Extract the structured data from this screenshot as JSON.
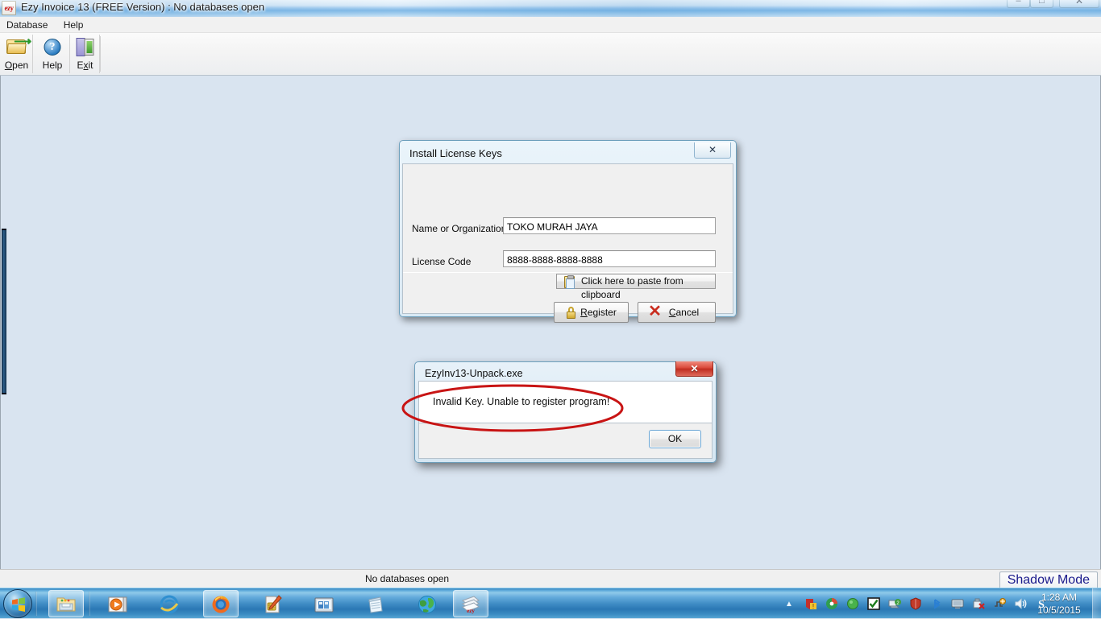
{
  "window": {
    "app_icon": "ezy",
    "title": "Ezy Invoice 13 (FREE Version)  : No databases open",
    "minimize_glyph": "–",
    "maximize_glyph": "□",
    "close_glyph": "✕"
  },
  "menu": {
    "items": [
      {
        "label": "Database"
      },
      {
        "label": "Help"
      }
    ]
  },
  "toolbar": {
    "open": {
      "label": "Open",
      "accel": "O",
      "rest": "pen",
      "icon": "open-folder-icon"
    },
    "help": {
      "label": "Help",
      "icon": "help-circle-icon",
      "glyph": "?"
    },
    "exit": {
      "label": "Exit",
      "accel": "x",
      "pre": "E",
      "rest": "it",
      "icon": "exit-door-icon"
    }
  },
  "status_bar": {
    "text": "No databases open",
    "shadow_mode": "Shadow Mode"
  },
  "license_dialog": {
    "title": "Install License Keys",
    "close_glyph": "✕",
    "name_label": "Name or Organization",
    "name_value": "TOKO MURAH JAYA",
    "name_placeholder": "",
    "code_label": "License Code",
    "code_value": "8888-8888-8888-8888",
    "code_placeholder": "",
    "paste_button": "Click here to paste from clipboard",
    "paste_icon": "clipboard-icon",
    "register_button": {
      "pre": "",
      "accel": "R",
      "rest": "egister",
      "icon": "lock-icon"
    },
    "cancel_button": {
      "pre": "",
      "accel": "C",
      "rest": "ancel",
      "icon": "red-x-icon"
    }
  },
  "error_dialog": {
    "title": "EzyInv13-Unpack.exe",
    "close_glyph": "✕",
    "message": "Invalid Key. Unable to register program!",
    "ok_button": "OK"
  },
  "annotation": {
    "shape": "red-ellipse",
    "color": "#c81414"
  },
  "taskbar": {
    "start_button": "start-orb",
    "items": [
      {
        "name": "windows-explorer",
        "icon": "folder-icon",
        "active": true
      },
      {
        "name": "windows-media-player",
        "icon": "media-player-icon",
        "active": false
      },
      {
        "name": "internet-explorer",
        "icon": "ie-icon",
        "active": false
      },
      {
        "name": "mozilla-firefox",
        "icon": "firefox-icon",
        "active": true
      },
      {
        "name": "sim-card-tool",
        "icon": "sim-card-icon",
        "active": false
      },
      {
        "name": "photo-viewer",
        "icon": "photos-icon",
        "active": false
      },
      {
        "name": "notepad-app",
        "icon": "notepad-icon",
        "active": false
      },
      {
        "name": "globe-app",
        "icon": "globe-icon",
        "active": false
      },
      {
        "name": "ezy-invoice",
        "icon": "ezy-icon",
        "active": true
      }
    ],
    "tray": {
      "overflow_glyph": "▲",
      "icons": [
        {
          "name": "kaspersky-warning-icon",
          "color": "#d03030"
        },
        {
          "name": "disk-tool-icon",
          "color": "#2f9e4f"
        },
        {
          "name": "green-ball-icon",
          "color": "#49b24b"
        },
        {
          "name": "checkmark-icon",
          "color": "#1a1a1a"
        },
        {
          "name": "network-icon",
          "color": "#3f9e3f"
        },
        {
          "name": "shield-icon",
          "color": "#c23a2a"
        },
        {
          "name": "bluetooth-icon",
          "color": "#2a7fd4"
        },
        {
          "name": "display-icon",
          "color": "#b9c6d2"
        },
        {
          "name": "safely-remove-icon",
          "color": "#d03030"
        },
        {
          "name": "action-center-icon",
          "color": "#e8a020"
        },
        {
          "name": "volume-icon",
          "color": "#e9f2f8"
        },
        {
          "name": "s-app-icon",
          "color": "#ffffff"
        }
      ],
      "time": "1:28 AM",
      "date": "10/5/2015"
    }
  }
}
